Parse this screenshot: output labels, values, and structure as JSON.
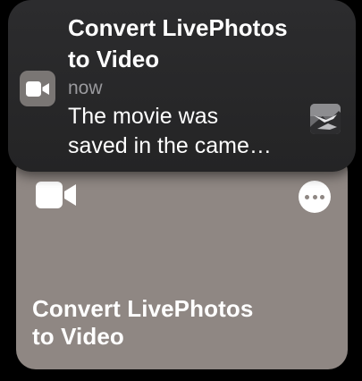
{
  "shortcut_card": {
    "title": "Convert LivePhotos to Video",
    "title_line1": "Convert LivePhotos",
    "title_line2": "to Video",
    "icon": "video-camera-icon",
    "more_icon": "ellipsis-icon",
    "background_color": "#8f8783"
  },
  "notification": {
    "title_line1": "Convert LivePhotos",
    "title_line2": "to Video",
    "time": "now",
    "body_line1": "The movie was",
    "body_line2": "saved in the came…",
    "app_icon": "video-camera-icon",
    "thumbnail_icon": "photo-thumbnail-icon",
    "background_color": "#2c2c2e"
  }
}
